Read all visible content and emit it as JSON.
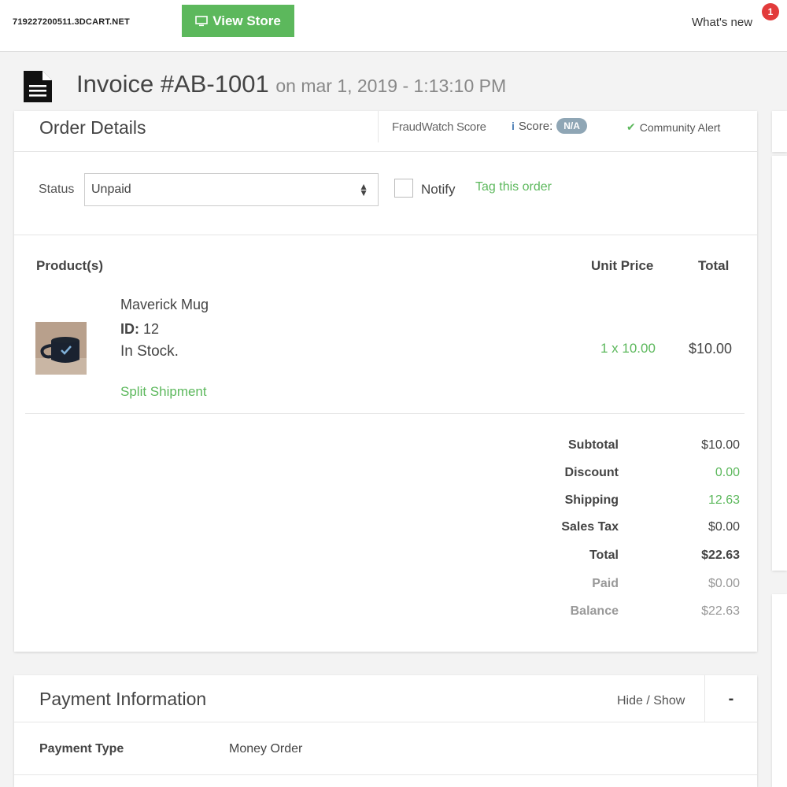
{
  "topbar": {
    "store_url": "719227200511.3DCART.NET",
    "view_store_label": "View Store",
    "whats_new_label": "What's new",
    "notification_count": "1"
  },
  "invoice": {
    "title": "Invoice #AB-1001",
    "date": "on mar 1, 2019 - 1:13:10 PM"
  },
  "order_details": {
    "title": "Order Details",
    "fraud_label": "FraudWatch Score",
    "score_label": "Score:",
    "score_value": "N/A",
    "community_alert": "Community Alert",
    "status_label": "Status",
    "status_value": "Unpaid",
    "notify_label": "Notify",
    "tag_link": "Tag this order",
    "columns": {
      "products": "Product(s)",
      "unit_price": "Unit Price",
      "total": "Total"
    },
    "items": [
      {
        "name": "Maverick Mug",
        "id_label": "ID:",
        "id_value": "12",
        "stock": "In Stock.",
        "split_link": "Split Shipment",
        "qty_price": "1 x 10.00",
        "total": "$10.00"
      }
    ],
    "totals": [
      {
        "label": "Subtotal",
        "value": "$10.00"
      },
      {
        "label": "Discount",
        "value": "0.00"
      },
      {
        "label": "Shipping",
        "value": "12.63"
      },
      {
        "label": "Sales Tax",
        "value": "$0.00"
      },
      {
        "label": "Total",
        "value": "$22.63"
      },
      {
        "label": "Paid",
        "value": "$0.00"
      },
      {
        "label": "Balance",
        "value": "$22.63"
      }
    ]
  },
  "payment": {
    "title": "Payment Information",
    "hide_show": "Hide / Show",
    "collapse_symbol": "-",
    "type_label": "Payment Type",
    "type_value": "Money Order"
  },
  "icons": {
    "document": "document-icon",
    "monitor": "monitor-icon",
    "info": "info-icon",
    "check": "check-icon",
    "caret": "select-caret-icon"
  },
  "colors": {
    "accent_green": "#5cb85c",
    "badge_red": "#e23b3b",
    "score_pill": "#8fa6b5"
  }
}
